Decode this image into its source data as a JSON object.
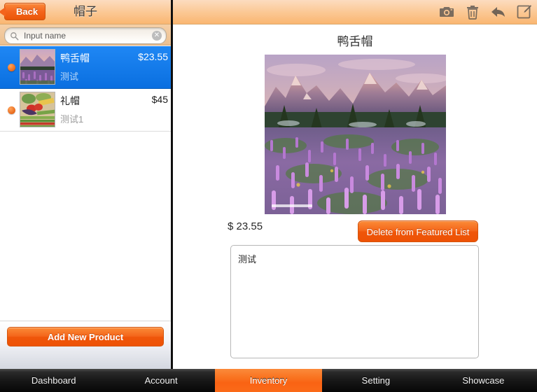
{
  "left_panel": {
    "back_label": "Back",
    "title": "帽子",
    "search": {
      "placeholder": "Input name",
      "value": "",
      "clear_glyph": "✕"
    },
    "products": [
      {
        "name": "鸭舌帽",
        "price": "$23.55",
        "description": "测试",
        "selected": true,
        "thumb": "mountain-lupine-photo"
      },
      {
        "name": "礼帽",
        "price": "$45",
        "description": "测试1",
        "selected": false,
        "thumb": "vegetables-photo"
      }
    ],
    "add_product_label": "Add New Product"
  },
  "right_panel": {
    "toolbar_icons": [
      "camera-icon",
      "trash-icon",
      "undo-arrow-icon",
      "compose-icon"
    ],
    "detail": {
      "title": "鸭舌帽",
      "image": "mountain-lupine-photo",
      "price": "$ 23.55",
      "delete_featured_label": "Delete from Featured List",
      "description": "测试"
    }
  },
  "tab_bar": {
    "tabs": [
      {
        "label": "Dashboard",
        "active": false
      },
      {
        "label": "Account",
        "active": false
      },
      {
        "label": "Inventory",
        "active": true
      },
      {
        "label": "Setting",
        "active": false
      },
      {
        "label": "Showcase",
        "active": false
      }
    ]
  },
  "colors": {
    "accent_orange": "#f4651a",
    "header_peach": "#fbc894",
    "selection_blue": "#1f87f4",
    "tab_bar_dark": "#151515"
  }
}
